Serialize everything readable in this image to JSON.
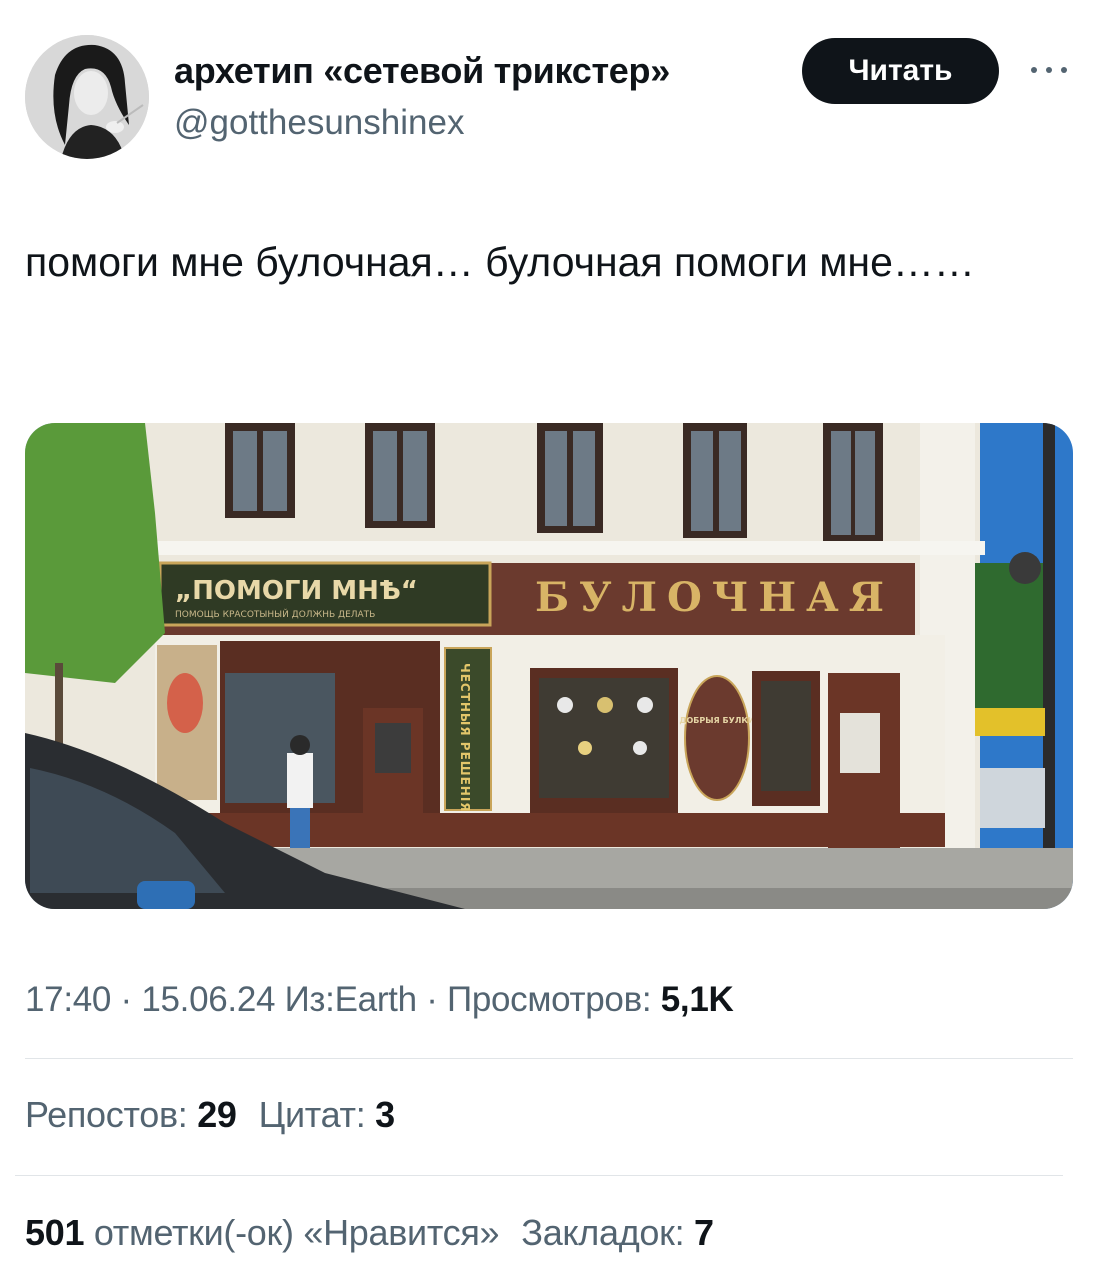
{
  "author": {
    "display_name": "архетип «сетевой трикстер»",
    "handle": "@gotthesunshinex"
  },
  "actions": {
    "follow_label": "Читать",
    "more_icon": "more-horizontal-icon"
  },
  "tweet": {
    "text": "помоги мне булочная… булочная помоги мне……"
  },
  "media": {
    "sign_left": "„ПОМОГИ МНѢ“",
    "sign_left_sub": "ПОМОЩЬ КРАСОТЫНЫЙ ДОЛЖНЬ ДЕЛАТЬ",
    "sign_right": "БУЛОЧНАЯ",
    "vertical_sign": "ЧЕСТНЫЯ РЕШЕНІЯ",
    "oval_sign": "ДОБРЫЯ БУЛКИ"
  },
  "meta": {
    "time": "17:40",
    "sep1": " · ",
    "date": "15.06.24",
    "source": " Из:Earth",
    "sep2": " · ",
    "views_label": "Просмотров: ",
    "views_count": "5,1K"
  },
  "stats": {
    "reposts_label": "Репостов: ",
    "reposts_count": "29",
    "quotes_label": "Цитат: ",
    "quotes_count": "3",
    "likes_count": "501",
    "likes_label": " отметки(-ок) «Нравится»",
    "bookmarks_label": "Закладок: ",
    "bookmarks_count": "7"
  }
}
